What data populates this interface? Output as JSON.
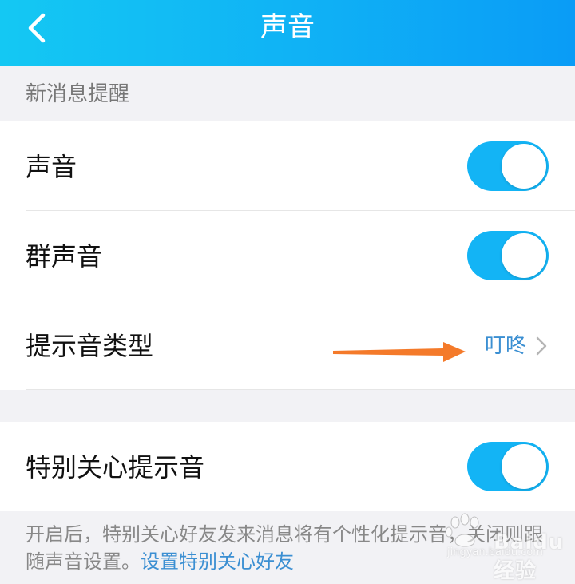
{
  "header": {
    "title": "声音",
    "back_icon": "back-chevron-icon"
  },
  "section": {
    "title": "新消息提醒"
  },
  "settings": {
    "sound": {
      "label": "声音",
      "enabled": true
    },
    "group_sound": {
      "label": "群声音",
      "enabled": true
    },
    "tone_type": {
      "label": "提示音类型",
      "value": "叮咚"
    },
    "special_care_tone": {
      "label": "特别关心提示音",
      "enabled": true
    }
  },
  "footer": {
    "text": "开启后，特别关心好友发来消息将有个性化提示音，关闭则跟随声音设置。",
    "link": "设置特别关心好友"
  },
  "watermark": {
    "text": "Baidu经验",
    "url": "jingyan.baidu.com"
  },
  "colors": {
    "header_start": "#14c8f3",
    "header_end": "#0a9cf6",
    "toggle_on": "#13b4f5",
    "link": "#3b8fd2",
    "annotation_arrow": "#f47a2a"
  }
}
